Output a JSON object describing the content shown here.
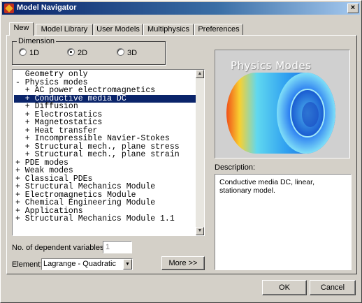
{
  "window": {
    "title": "Model Navigator",
    "close_label": "×"
  },
  "tabs": [
    {
      "label": "New"
    },
    {
      "label": "Model Library"
    },
    {
      "label": "User Models"
    },
    {
      "label": "Multiphysics"
    },
    {
      "label": "Preferences"
    }
  ],
  "active_tab": "New",
  "dimension": {
    "legend": "Dimension",
    "options": [
      {
        "label": "1D",
        "selected": false
      },
      {
        "label": "2D",
        "selected": true
      },
      {
        "label": "3D",
        "selected": false
      }
    ]
  },
  "tree": {
    "items": [
      "  Geometry only",
      "- Physics modes",
      "  + AC power electromagnetics",
      "  + Conductive media DC",
      "  + Diffusion",
      "  + Electrostatics",
      "  + Magnetostatics",
      "  + Heat transfer",
      "  + Incompressible Navier-Stokes",
      "  + Structural mech., plane stress",
      "  + Structural mech., plane strain",
      "+ PDE modes",
      "+ Weak modes",
      "+ Classical PDEs",
      "+ Structural Mechanics Module",
      "+ Electromagnetics Module",
      "+ Chemical Engineering Module",
      "+ Applications",
      "+ Structural Mechanics Module 1.1"
    ],
    "selected_index": 3
  },
  "preview": {
    "title": "Physics Modes"
  },
  "description": {
    "label": "Description:",
    "text": "Conductive media DC, linear, stationary model."
  },
  "dependent_vars": {
    "label": "No. of dependent variables:",
    "value": "1"
  },
  "element": {
    "label": "Element:",
    "value": "Lagrange - Quadratic"
  },
  "buttons": {
    "more": "More >>",
    "ok": "OK",
    "cancel": "Cancel"
  },
  "colors": {
    "title_start": "#0a246a",
    "title_end": "#a6caf0",
    "selection": "#0a246a",
    "face": "#d4d0c8"
  }
}
